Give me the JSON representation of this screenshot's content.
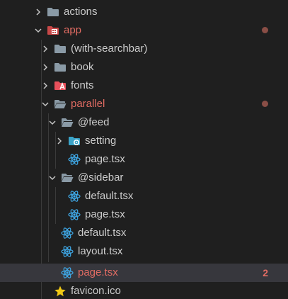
{
  "explorer": {
    "items": [
      {
        "label": "actions",
        "kind": "folder",
        "state": "collapsed"
      },
      {
        "label": "app",
        "kind": "folder-app",
        "state": "expanded",
        "modified": true,
        "status": "dot"
      },
      {
        "label": "(with-searchbar)",
        "kind": "folder",
        "state": "collapsed"
      },
      {
        "label": "book",
        "kind": "folder",
        "state": "collapsed"
      },
      {
        "label": "fonts",
        "kind": "folder-fonts",
        "state": "collapsed"
      },
      {
        "label": "parallel",
        "kind": "folder",
        "state": "expanded",
        "modified": true,
        "status": "dot"
      },
      {
        "label": "@feed",
        "kind": "folder",
        "state": "expanded"
      },
      {
        "label": "setting",
        "kind": "folder-config",
        "state": "collapsed"
      },
      {
        "label": "page.tsx",
        "kind": "react-file"
      },
      {
        "label": "@sidebar",
        "kind": "folder",
        "state": "expanded"
      },
      {
        "label": "default.tsx",
        "kind": "react-file"
      },
      {
        "label": "page.tsx",
        "kind": "react-file"
      },
      {
        "label": "default.tsx",
        "kind": "react-file"
      },
      {
        "label": "layout.tsx",
        "kind": "react-file"
      },
      {
        "label": "page.tsx",
        "kind": "react-file",
        "modified": true,
        "selected": true,
        "problems": "2"
      },
      {
        "label": "favicon.ico",
        "kind": "favicon-file"
      }
    ]
  },
  "colors": {
    "background": "#1f1f1f",
    "selected_row": "#37373d",
    "modified_text": "#e26c63",
    "folder_gray": "#8a9aa6",
    "react_blue": "#3fa9e8",
    "fonts_red": "#e8505b",
    "star_yellow": "#f0c814"
  }
}
